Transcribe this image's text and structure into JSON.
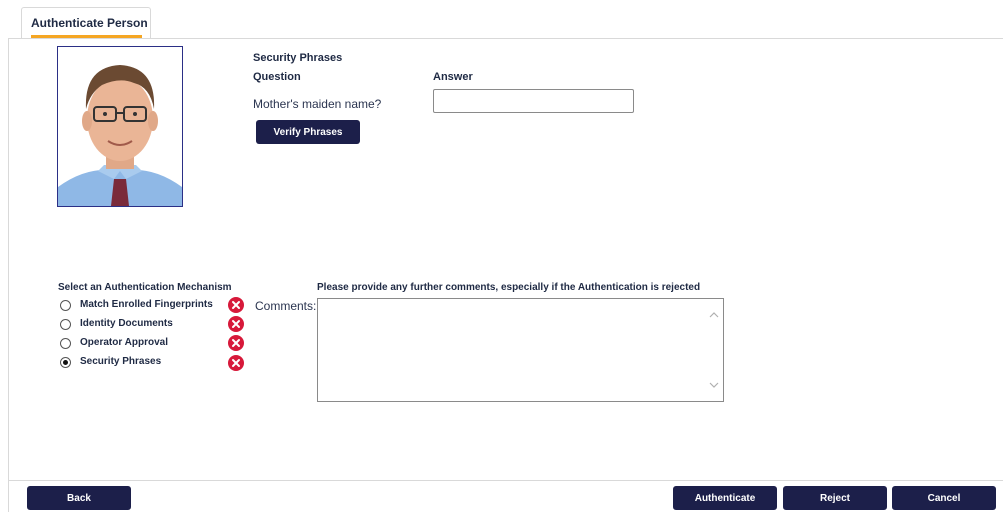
{
  "tab": {
    "label": "Authenticate Person"
  },
  "security": {
    "title": "Security Phrases",
    "question_header": "Question",
    "answer_header": "Answer",
    "question": "Mother's maiden name?",
    "answer_value": "",
    "verify_label": "Verify Phrases"
  },
  "mechanism": {
    "title": "Select an Authentication Mechanism",
    "options": [
      {
        "label": "Match Enrolled Fingerprints",
        "selected": false,
        "status_icon": "error-x-icon"
      },
      {
        "label": "Identity Documents",
        "selected": false,
        "status_icon": "error-x-icon"
      },
      {
        "label": "Operator Approval",
        "selected": false,
        "status_icon": "error-x-icon"
      },
      {
        "label": "Security Phrases",
        "selected": true,
        "status_icon": "error-x-icon"
      }
    ]
  },
  "comments": {
    "hint": "Please provide any further comments, especially if the Authentication is rejected",
    "label": "Comments:",
    "value": ""
  },
  "footer": {
    "back": "Back",
    "authenticate": "Authenticate",
    "reject": "Reject",
    "cancel": "Cancel"
  },
  "colors": {
    "accent": "#f5a623",
    "button_bg": "#1c1f4a",
    "error": "#d7193a",
    "photo_border": "#2b2f86"
  }
}
